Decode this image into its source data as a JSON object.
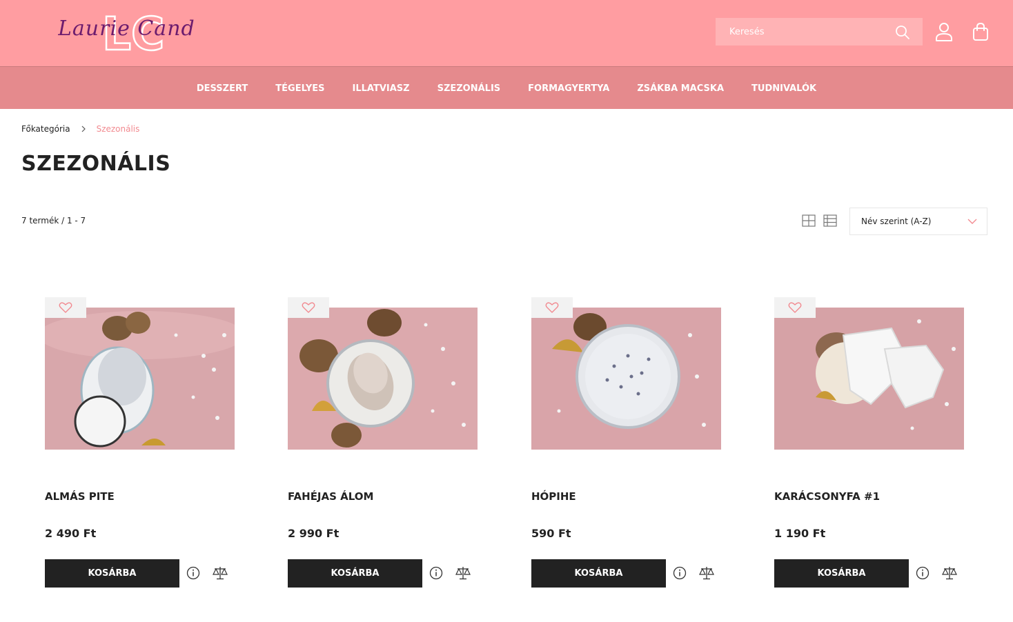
{
  "header": {
    "logo_text": "Laurie Candle",
    "logo_monogram": "LC",
    "search": {
      "placeholder": "Keresés"
    },
    "nav": [
      "DESSZERT",
      "TÉGELYES",
      "ILLATVIASZ",
      "SZEZONÁLIS",
      "FORMAGYERTYA",
      "ZSÁKBA MACSKA",
      "TUDNIVALÓK"
    ]
  },
  "breadcrumb": {
    "home": "Főkategória",
    "current": "Szezonális"
  },
  "page": {
    "title": "SZEZONÁLIS",
    "count_text": "7 termék / 1 - 7",
    "sort": {
      "selected": "Név szerint (A-Z)"
    }
  },
  "products": [
    {
      "name": "ALMÁS PITE",
      "price": "2 490 Ft",
      "button": "KOSÁRBA"
    },
    {
      "name": "FAHÉJAS ÁLOM",
      "price": "2 990 Ft",
      "button": "KOSÁRBA"
    },
    {
      "name": "HÓPIHE",
      "price": "590 Ft",
      "button": "KOSÁRBA"
    },
    {
      "name": "KARÁCSONYFA #1",
      "price": "1 190 Ft",
      "button": "KOSÁRBA"
    }
  ],
  "colors": {
    "header_bg": "#ff9da1",
    "nav_bg": "#e58a8d",
    "accent": "#f28a90",
    "button_bg": "#222222"
  },
  "icons": [
    "search-icon",
    "user-icon",
    "cart-icon",
    "chevron-right-icon",
    "grid-view-icon",
    "list-view-icon",
    "chevron-down-icon",
    "heart-icon",
    "info-icon",
    "compare-icon"
  ]
}
